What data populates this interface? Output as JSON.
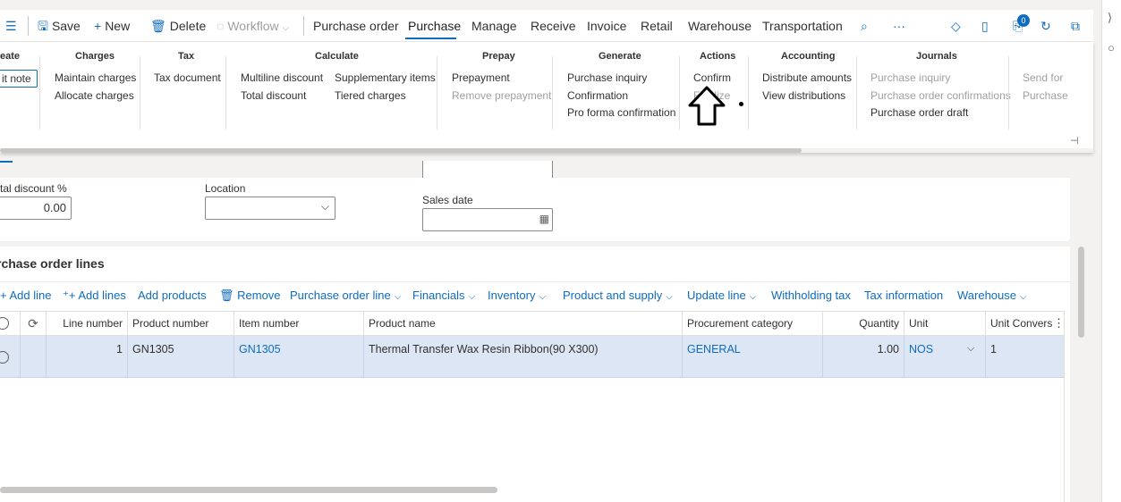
{
  "toolbar": {
    "save": "Save",
    "new": "New",
    "delete": "Delete",
    "workflow": "Workflow",
    "tabs": [
      "Purchase order",
      "Purchase",
      "Manage",
      "Receive",
      "Invoice",
      "Retail",
      "Warehouse",
      "Transportation"
    ],
    "active_tab": "Purchase",
    "more": "···",
    "notification_count": "0"
  },
  "ribbon": {
    "groups": {
      "create": {
        "title": "eate",
        "items": [
          "it note"
        ]
      },
      "charges": {
        "title": "Charges",
        "items": [
          "Maintain charges",
          "Allocate charges"
        ]
      },
      "tax": {
        "title": "Tax",
        "items": [
          "Tax document"
        ]
      },
      "calculate": {
        "title": "Calculate",
        "items": [
          "Multiline discount",
          "Total discount",
          "Supplementary items",
          "Tiered charges"
        ]
      },
      "prepay": {
        "title": "Prepay",
        "items": [
          "Prepayment",
          "Remove prepayment"
        ]
      },
      "generate": {
        "title": "Generate",
        "items": [
          "Purchase inquiry",
          "Confirmation",
          "Pro forma confirmation"
        ]
      },
      "actions": {
        "title": "Actions",
        "items": [
          "Confirm",
          "Finalize"
        ]
      },
      "accounting": {
        "title": "Accounting",
        "items": [
          "Distribute amounts",
          "View distributions"
        ]
      },
      "journals": {
        "title": "Journals",
        "items": [
          "Purchase inquiry",
          "Purchase order confirmations",
          "Purchase order draft"
        ]
      },
      "send": {
        "items": [
          "Send for",
          "Purchase"
        ]
      }
    }
  },
  "header_form": {
    "total_discount_label": "tal discount %",
    "total_discount_value": "0.00",
    "location_label": "Location",
    "location_value": "",
    "sales_date_label": "Sales date",
    "sales_date_value": ""
  },
  "lines": {
    "title": "rchase order lines",
    "toolbar": [
      "Add line",
      "Add lines",
      "Add products",
      "Remove",
      "Purchase order line",
      "Financials",
      "Inventory",
      "Product and supply",
      "Update line",
      "Withholding tax",
      "Tax information",
      "Warehouse"
    ],
    "columns": [
      "Line number",
      "Product number",
      "Item number",
      "Product name",
      "Procurement category",
      "Quantity",
      "Unit",
      "Unit Conversic"
    ],
    "rows": [
      {
        "line_number": "1",
        "product_number": "GN1305",
        "item_number": "GN1305",
        "product_name": "Thermal Transfer Wax Resin Ribbon(90 X300)",
        "procurement_category": "GENERAL",
        "quantity": "1.00",
        "unit": "NOS",
        "unit_conversion": "1"
      }
    ]
  },
  "colors": {
    "accent": "#0f6cbd",
    "selected_row": "#dde6f5"
  }
}
